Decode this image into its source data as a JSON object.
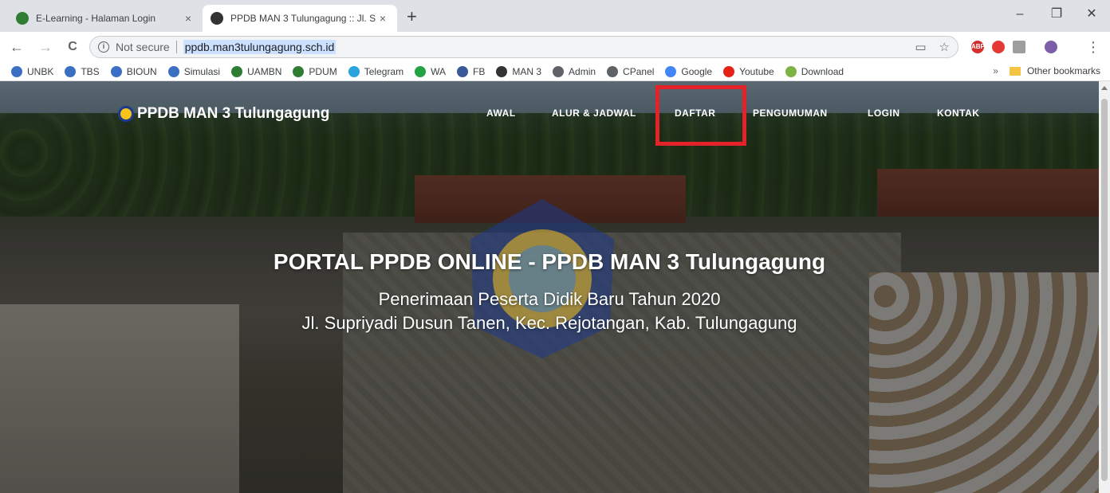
{
  "browser": {
    "tabs": [
      {
        "title": "E-Learning - Halaman Login",
        "favicon": "school-emblem-icon",
        "active": false
      },
      {
        "title": "PPDB MAN 3 Tulungagung :: Jl. S",
        "favicon": "globe-icon",
        "active": true
      }
    ],
    "new_tab_label": "+",
    "close_glyph": "×",
    "window": {
      "minimize": "–",
      "restore": "❐",
      "close": "✕"
    },
    "nav": {
      "back": "←",
      "forward": "→",
      "reload": "C"
    },
    "omnibox": {
      "security": "Not secure",
      "url": "ppdb.man3tulungagung.sch.id"
    },
    "bookmarks": [
      {
        "label": "UNBK",
        "icon": "blue-globe-icon",
        "color": "#3b6fc4"
      },
      {
        "label": "TBS",
        "icon": "blue-globe-icon",
        "color": "#3b6fc4"
      },
      {
        "label": "BIOUN",
        "icon": "blue-globe-icon",
        "color": "#3b6fc4"
      },
      {
        "label": "Simulasi",
        "icon": "blue-globe-icon",
        "color": "#3b6fc4"
      },
      {
        "label": "UAMBN",
        "icon": "green-emblem-icon",
        "color": "#2e7d32"
      },
      {
        "label": "PDUM",
        "icon": "green-emblem-icon",
        "color": "#2e7d32"
      },
      {
        "label": "Telegram",
        "icon": "telegram-icon",
        "color": "#2aa3df"
      },
      {
        "label": "WA",
        "icon": "whatsapp-icon",
        "color": "#25a244"
      },
      {
        "label": "FB",
        "icon": "facebook-icon",
        "color": "#3b5998"
      },
      {
        "label": "MAN 3",
        "icon": "dark-globe-icon",
        "color": "#333333"
      },
      {
        "label": "Admin",
        "icon": "gray-globe-icon",
        "color": "#5f6368"
      },
      {
        "label": "CPanel",
        "icon": "gray-globe-icon",
        "color": "#5f6368"
      },
      {
        "label": "Google",
        "icon": "google-icon",
        "color": "#4285f4"
      },
      {
        "label": "Youtube",
        "icon": "youtube-icon",
        "color": "#e62117"
      },
      {
        "label": "Download",
        "icon": "download-arrow-icon",
        "color": "#7cb342"
      }
    ],
    "bookmarks_overflow": "»",
    "other_bookmarks": "Other bookmarks"
  },
  "site": {
    "brand": "PPDB MAN 3 Tulungagung",
    "menu": [
      "AWAL",
      "ALUR & JADWAL",
      "DAFTAR",
      "PENGUMUMAN",
      "LOGIN",
      "KONTAK"
    ],
    "highlighted_item": "DAFTAR",
    "highlight_color": "#e32229",
    "hero": {
      "title": "PORTAL PPDB ONLINE - PPDB MAN 3 Tulungagung",
      "subtitle_line1": "Penerimaan Peserta Didik Baru Tahun 2020",
      "subtitle_line2": "Jl. Supriyadi Dusun Tanen, Kec. Rejotangan, Kab. Tulungagung"
    }
  }
}
